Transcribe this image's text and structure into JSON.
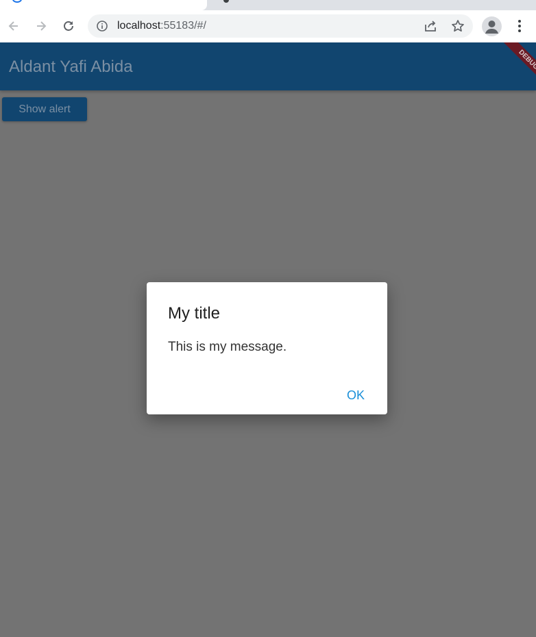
{
  "browser": {
    "url_host": "localhost",
    "url_path": ":55183/#/"
  },
  "appbar": {
    "title": "Aldant Yafi Abida",
    "debug_banner": "DEBUG"
  },
  "main": {
    "show_alert_label": "Show alert"
  },
  "dialog": {
    "title": "My title",
    "message": "This is my message.",
    "ok_label": "OK"
  },
  "colors": {
    "appbar": "#11456f",
    "scrim_background": "#737373",
    "dialog_action": "#1a8fd8",
    "debug_ribbon": "#6b1a24"
  },
  "icons": [
    "back-arrow-icon",
    "forward-arrow-icon",
    "reload-icon",
    "info-icon",
    "share-icon",
    "star-icon",
    "profile-icon",
    "kebab-menu-icon"
  ]
}
